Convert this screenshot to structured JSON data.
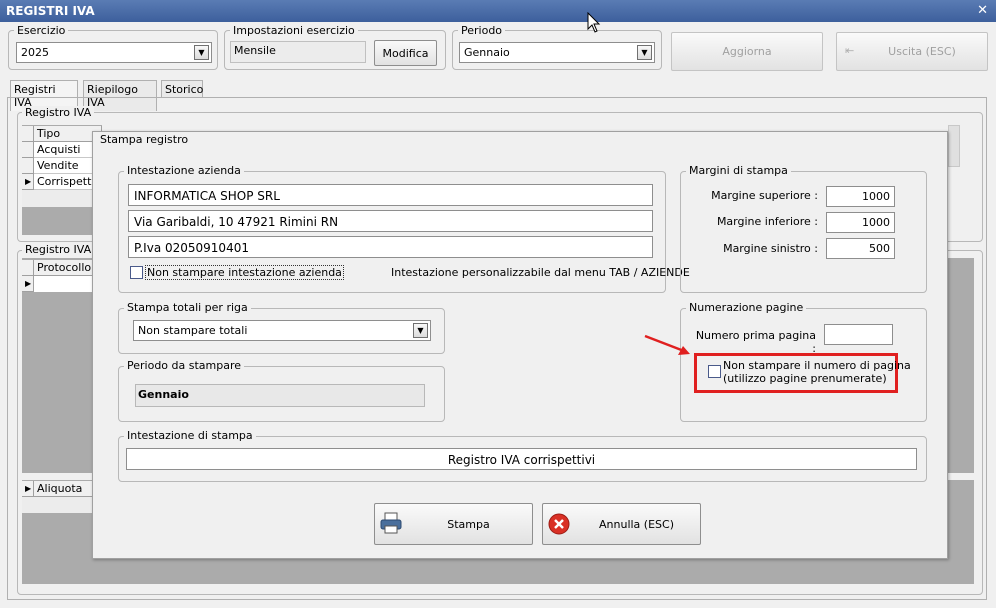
{
  "window": {
    "title": "REGISTRI IVA",
    "close_glyph": "✕"
  },
  "esercizio": {
    "label": "Esercizio",
    "value": "2025"
  },
  "impostazioni": {
    "label": "Impostazioni esercizio",
    "value": "Mensile",
    "button": "Modifica"
  },
  "periodo": {
    "label": "Periodo",
    "value": "Gennaio"
  },
  "toolbar": {
    "aggiorna": "Aggiorna",
    "uscita": "Uscita (ESC)"
  },
  "tabs": [
    "Registri IVA",
    "Riepilogo IVA",
    "Storico"
  ],
  "registri_group": {
    "label": "Registro IVA",
    "col_tipo": "Tipo",
    "rows": [
      "Acquisti",
      "Vendite",
      "Corrispettivi"
    ]
  },
  "registro_c_group": {
    "label": "Registro IVA c",
    "col_protocollo": "Protocollo"
  },
  "aliquota": {
    "label": "Aliquota"
  },
  "dialog": {
    "title": "Stampa registro",
    "intestazione": {
      "label": "Intestazione azienda",
      "line1": "INFORMATICA SHOP SRL",
      "line2": "Via Garibaldi, 10   47921 Rimini RN",
      "line3": "P.Iva 02050910401",
      "checkbox_label": "Non stampare intestazione azienda",
      "hint": "Intestazione personalizzabile dal menu TAB / AZIENDE"
    },
    "margini": {
      "label": "Margini di stampa",
      "superiore_label": "Margine superiore :",
      "superiore": "1000",
      "inferiore_label": "Margine inferiore :",
      "inferiore": "1000",
      "sinistro_label": "Margine sinistro :",
      "sinistro": "500"
    },
    "totali": {
      "label": "Stampa totali per riga",
      "value": "Non stampare totali"
    },
    "numerazione": {
      "label": "Numerazione pagine",
      "prima_label": "Numero prima pagina :",
      "prima_value": "",
      "checkbox_line1": "Non stampare il numero di pagina",
      "checkbox_line2": "(utilizzo pagine prenumerate)"
    },
    "periodo": {
      "label": "Periodo da stampare",
      "value": "Gennaio"
    },
    "intestazione_stampa": {
      "label": "Intestazione di stampa",
      "value": "Registro IVA corrispettivi"
    },
    "buttons": {
      "stampa": "Stampa",
      "annulla": "Annulla (ESC)"
    }
  },
  "colors": {
    "titlebar": "#3d5f9c",
    "highlight_red": "#e02020",
    "grid_gray": "#ababab"
  },
  "icons": [
    "close-icon",
    "dropdown-arrow-icon",
    "printer-icon",
    "cancel-icon",
    "exit-icon",
    "row-pointer-icon",
    "red-arrow-annotation"
  ]
}
